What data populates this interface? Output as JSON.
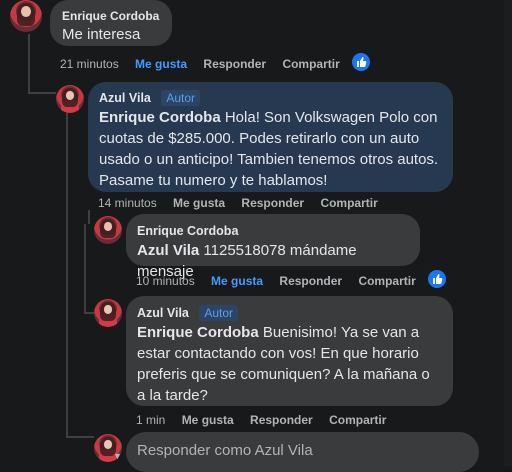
{
  "comment1": {
    "author": "Enrique Cordoba",
    "text": "Me interesa",
    "time": "21 minutos",
    "like": "Me gusta",
    "reply": "Responder",
    "share": "Compartir"
  },
  "reply1": {
    "author": "Azul Vila",
    "badge": "Autor",
    "mention": "Enrique Cordoba",
    "text": "Hola! Son Volkswagen Polo con cuotas de $285.000. Podes retirarlo con un auto usado o un anticipo! Tambien tenemos otros autos. Pasame tu numero y te hablamos!",
    "time": "14 minutos",
    "like": "Me gusta",
    "reply": "Responder",
    "share": "Compartir"
  },
  "reply2": {
    "author": "Enrique Cordoba",
    "mention": "Azul Vila",
    "text": "1125518078 mándame mensaje",
    "time": "10 minutos",
    "like": "Me gusta",
    "reply": "Responder",
    "share": "Compartir"
  },
  "reply3": {
    "author": "Azul Vila",
    "badge": "Autor",
    "mention": "Enrique Cordoba",
    "text": "Buenisimo! Ya se van a estar contactando con vos! En que horario preferis que se comuniquen? A la mañana o a la tarde?",
    "time": "1 min",
    "like": "Me gusta",
    "reply": "Responder",
    "share": "Compartir"
  },
  "reply_box": {
    "placeholder": "Responder como Azul Vila"
  },
  "colors": {
    "background": "#18191a",
    "bubble": "#3a3b3c",
    "bubble_own": "#263951",
    "accent": "#4599ff",
    "like_icon": "#1877f2"
  }
}
